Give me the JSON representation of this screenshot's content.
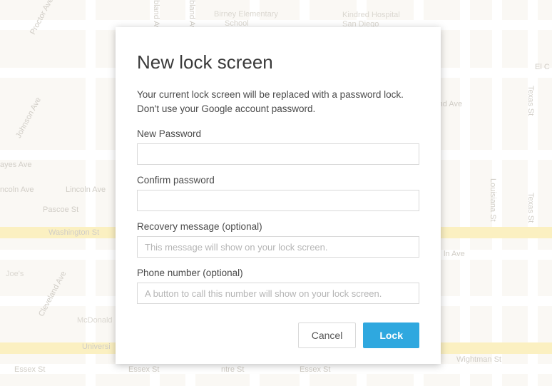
{
  "dialog": {
    "title": "New lock screen",
    "description": "Your current lock screen will be replaced with a password lock. Don't use your Google account password.",
    "fields": {
      "new_password": {
        "label": "New Password",
        "value": ""
      },
      "confirm_password": {
        "label": "Confirm password",
        "value": ""
      },
      "recovery_message": {
        "label": "Recovery message (optional)",
        "placeholder": "This message will show on your lock screen.",
        "value": ""
      },
      "phone_number": {
        "label": "Phone number (optional)",
        "placeholder": "A button to call this number will show on your lock screen.",
        "value": ""
      }
    },
    "buttons": {
      "cancel": "Cancel",
      "lock": "Lock"
    }
  },
  "map": {
    "labels": {
      "proctor": "Proctor Ave",
      "johnson": "Johnson Ave",
      "ayes": "ayes Ave",
      "lincoln_left": "ncoln Ave",
      "lincoln": "Lincoln Ave",
      "pascoe": "Pascoe St",
      "washington": "Washington St",
      "joes": "Joe's",
      "cleveland": "Cleveland Ave",
      "mcdonald": "McDonald",
      "university": "Universi",
      "essex_l": "Essex St",
      "essex_m": "Essex St",
      "ntre": "ntre St",
      "birney": "Birney Elementary",
      "school": "School",
      "kindred": "Kindred Hospital",
      "sandiego": "San Diego",
      "bland": "bland Ave",
      "elc": "El C",
      "texas": "Texas St",
      "texas2": "Texas St",
      "louisiana": "Louisiana St",
      "lnave": "ln Ave",
      "wightman": "Wightman St",
      "essex_r": "Essex St"
    }
  }
}
